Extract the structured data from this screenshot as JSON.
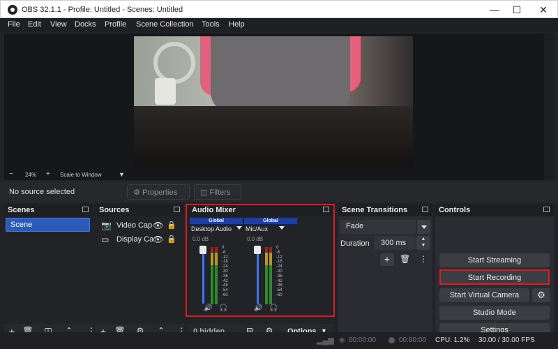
{
  "window": {
    "title": "OBS 32.1.1 - Profile: Untitled - Scenes: Untitled",
    "minimize": "—",
    "maximize": "☐",
    "close": "✕"
  },
  "menu": [
    "File",
    "Edit",
    "View",
    "Docks",
    "Profile",
    "Scene Collection",
    "Tools",
    "Help"
  ],
  "preview": {
    "zoom": "24%",
    "zoom_minus": "−",
    "zoom_plus": "+",
    "scale_mode": "Scale to Window"
  },
  "context": {
    "no_source": "No source selected",
    "properties": "Properties",
    "filters": "Filters"
  },
  "scenes": {
    "title": "Scenes",
    "items": [
      "Scene"
    ]
  },
  "sources": {
    "title": "Sources",
    "items": [
      {
        "label": "Video Cap",
        "icon": "camera-icon"
      },
      {
        "label": "Display Ca",
        "icon": "monitor-icon"
      }
    ]
  },
  "mixer": {
    "title": "Audio Mixer",
    "channels": [
      {
        "header": "Global",
        "name": "Desktop Audio",
        "db": "0.0 dB",
        "level": 1.0
      },
      {
        "header": "Global",
        "name": "Mic/Aux",
        "db": "0.0 dB",
        "level": 1.0
      }
    ],
    "ticks": [
      "0",
      "-6",
      "-12",
      "-18",
      "-24",
      "-30",
      "-36",
      "-42",
      "-48",
      "-54",
      "-60"
    ],
    "hidden": "0 hidden",
    "options": "Options"
  },
  "transitions": {
    "title": "Scene Transitions",
    "selected": "Fade",
    "duration_label": "Duration",
    "duration_value": "300 ms"
  },
  "controls": {
    "title": "Controls",
    "start_streaming": "Start Streaming",
    "start_recording": "Start Recording",
    "start_virtual_camera": "Start Virtual Camera",
    "studio_mode": "Studio Mode",
    "settings": "Settings"
  },
  "status": {
    "stream_time": "00:00:00",
    "rec_time": "00:00:00",
    "cpu": "CPU: 1.2%",
    "fps": "30.00 / 30.00 FPS"
  },
  "colors": {
    "accent": "#2a5bb8",
    "highlight": "#e01a22",
    "panel_bg": "#2b2c31",
    "app_bg": "#222327"
  }
}
